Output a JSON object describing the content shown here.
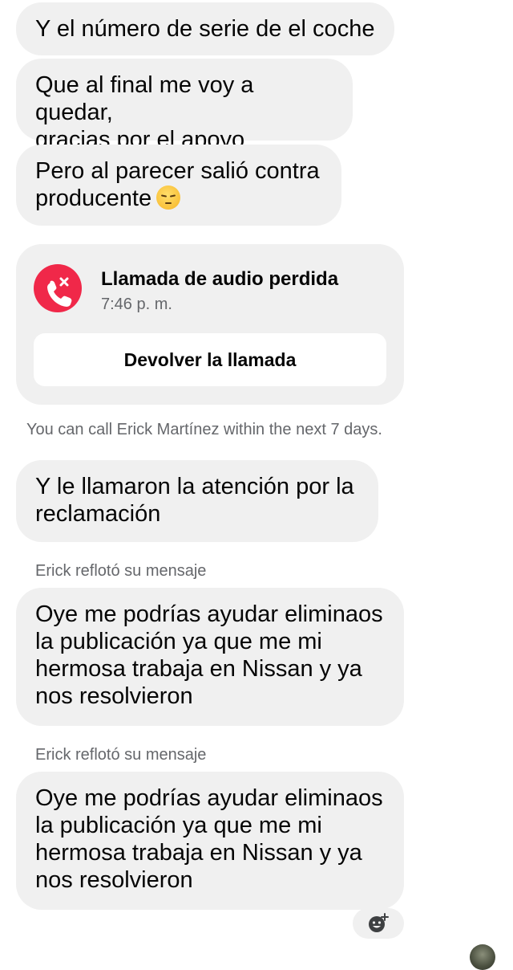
{
  "messages": [
    {
      "text": "Y el número de serie de el coche"
    },
    {
      "text": "Que al final me voy a quedar,\ngracias por el apoyo"
    },
    {
      "text": "Pero al parecer salió contra\nproducente",
      "emoji": "pensive-face"
    },
    {
      "text": "Y le llamaron la atención por la\nreclamación"
    },
    {
      "text": "Oye me podrías ayudar eliminaos\nla publicación ya que me mi\nhermosa trabaja en Nissan y ya\nnos resolvieron"
    },
    {
      "text": "Oye me podrías ayudar eliminaos\nla publicación ya que me mi\nhermosa trabaja en Nissan y ya\nnos resolvieron"
    }
  ],
  "missed_call": {
    "title": "Llamada de audio perdida",
    "time": "7:46 p. m.",
    "call_back_label": "Devolver la llamada",
    "icon": "missed-call-icon",
    "icon_color": "#f02849"
  },
  "system_note": "You can call Erick Martínez within the next 7 days.",
  "reply_notes": [
    "Erick reflotó su mensaje",
    "Erick reflotó su mensaje"
  ],
  "reaction_icon": "add-reaction-icon",
  "colors": {
    "bubble": "#f0f0f0",
    "meta_text": "#65676b"
  }
}
